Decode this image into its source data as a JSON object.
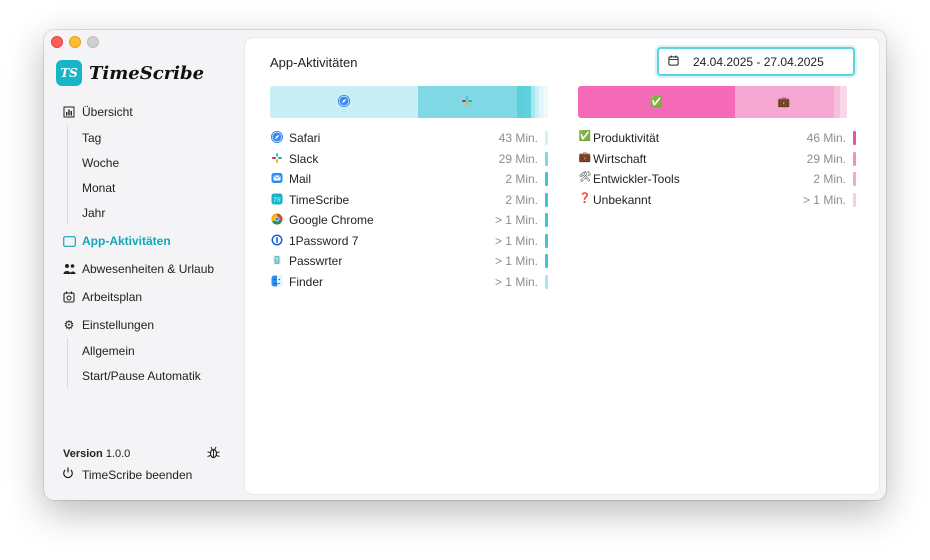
{
  "app": {
    "name": "TimeScribe",
    "logo_text": "TS"
  },
  "sidebar": {
    "items": [
      {
        "label": "Übersicht",
        "icon": "chart-icon"
      },
      {
        "label": "Tag"
      },
      {
        "label": "Woche"
      },
      {
        "label": "Monat"
      },
      {
        "label": "Jahr"
      },
      {
        "label": "App-Aktivitäten",
        "icon": "window-icon",
        "active": true
      },
      {
        "label": "Abwesenheiten & Urlaub",
        "icon": "people-icon"
      },
      {
        "label": "Arbeitsplan",
        "icon": "calendar-icon"
      },
      {
        "label": "Einstellungen",
        "icon": "gear-icon"
      },
      {
        "label": "Allgemein"
      },
      {
        "label": "Start/Pause Automatik"
      }
    ],
    "version_label": "Version",
    "version_number": "1.0.0",
    "quit_label": "TimeScribe beenden"
  },
  "main": {
    "title": "App-Aktivitäten",
    "date_range": "24.04.2025 - 27.04.2025",
    "apps": [
      {
        "name": "Safari",
        "value": "43 Min.",
        "color": "#1e88e5",
        "icon": "safari-icon"
      },
      {
        "name": "Slack",
        "value": "29 Min.",
        "color": "#7b3f7e",
        "icon": "slack-icon"
      },
      {
        "name": "Mail",
        "value": "2 Min.",
        "color": "#2b8cf2",
        "icon": "mail-icon"
      },
      {
        "name": "TimeScribe",
        "value": "2 Min.",
        "color": "#17b6c7",
        "icon": "timescribe-icon"
      },
      {
        "name": "Google Chrome",
        "value": "> 1 Min.",
        "color": "#db4437",
        "icon": "chrome-icon"
      },
      {
        "name": "1Password 7",
        "value": "> 1 Min.",
        "color": "#1a5bd6",
        "icon": "password-icon"
      },
      {
        "name": "Passwrter",
        "value": "> 1 Min.",
        "color": "#37b7e5",
        "icon": "passwords-icon"
      },
      {
        "name": "Finder",
        "value": "> 1 Min.",
        "color": "#2f8ff4",
        "icon": "finder-icon"
      }
    ],
    "categories": [
      {
        "name": "Produktivität",
        "value": "46 Min.",
        "emoji": "✅"
      },
      {
        "name": "Wirtschaft",
        "value": "29 Min.",
        "emoji": "💼"
      },
      {
        "name": "Entwickler-Tools",
        "value": "2 Min.",
        "emoji": "🛠"
      },
      {
        "name": "Unbekannt",
        "value": "> 1 Min.",
        "emoji": "❓"
      }
    ],
    "app_bar": [
      {
        "share": 0.5307,
        "color": "#c9eef3",
        "icon": "safari-icon"
      },
      {
        "share": 0.358,
        "color": "#7fd8e3",
        "icon": "slack-icon"
      },
      {
        "share": 0.0247,
        "color": "#5ccfdc"
      },
      {
        "share": 0.0247,
        "color": "#62d1de"
      },
      {
        "share": 0.0155,
        "color": "#a9e6ee"
      },
      {
        "share": 0.0155,
        "color": "#c9eef3"
      },
      {
        "share": 0.0155,
        "color": "#e4f6f9"
      },
      {
        "share": 0.0155,
        "color": "#eefafc"
      }
    ],
    "category_bar": [
      {
        "share": 0.5679,
        "color": "#f46ab6"
      },
      {
        "share": 0.358,
        "color": "#f5a7d2"
      },
      {
        "share": 0.0247,
        "color": "#f8bfdd"
      },
      {
        "share": 0.0247,
        "color": "#fbd7ea"
      }
    ],
    "app_ticks": [
      "#d3f1f6",
      "#7fd8e3",
      "#3fc6d6",
      "#3fc6d6",
      "#3fc6d6",
      "#3fc6d6",
      "#3fc6d6",
      "#a9e6ee"
    ],
    "category_ticks": [
      "#f04fa6",
      "#f48ec3",
      "#f6a7d1",
      "#f9cde5"
    ]
  }
}
